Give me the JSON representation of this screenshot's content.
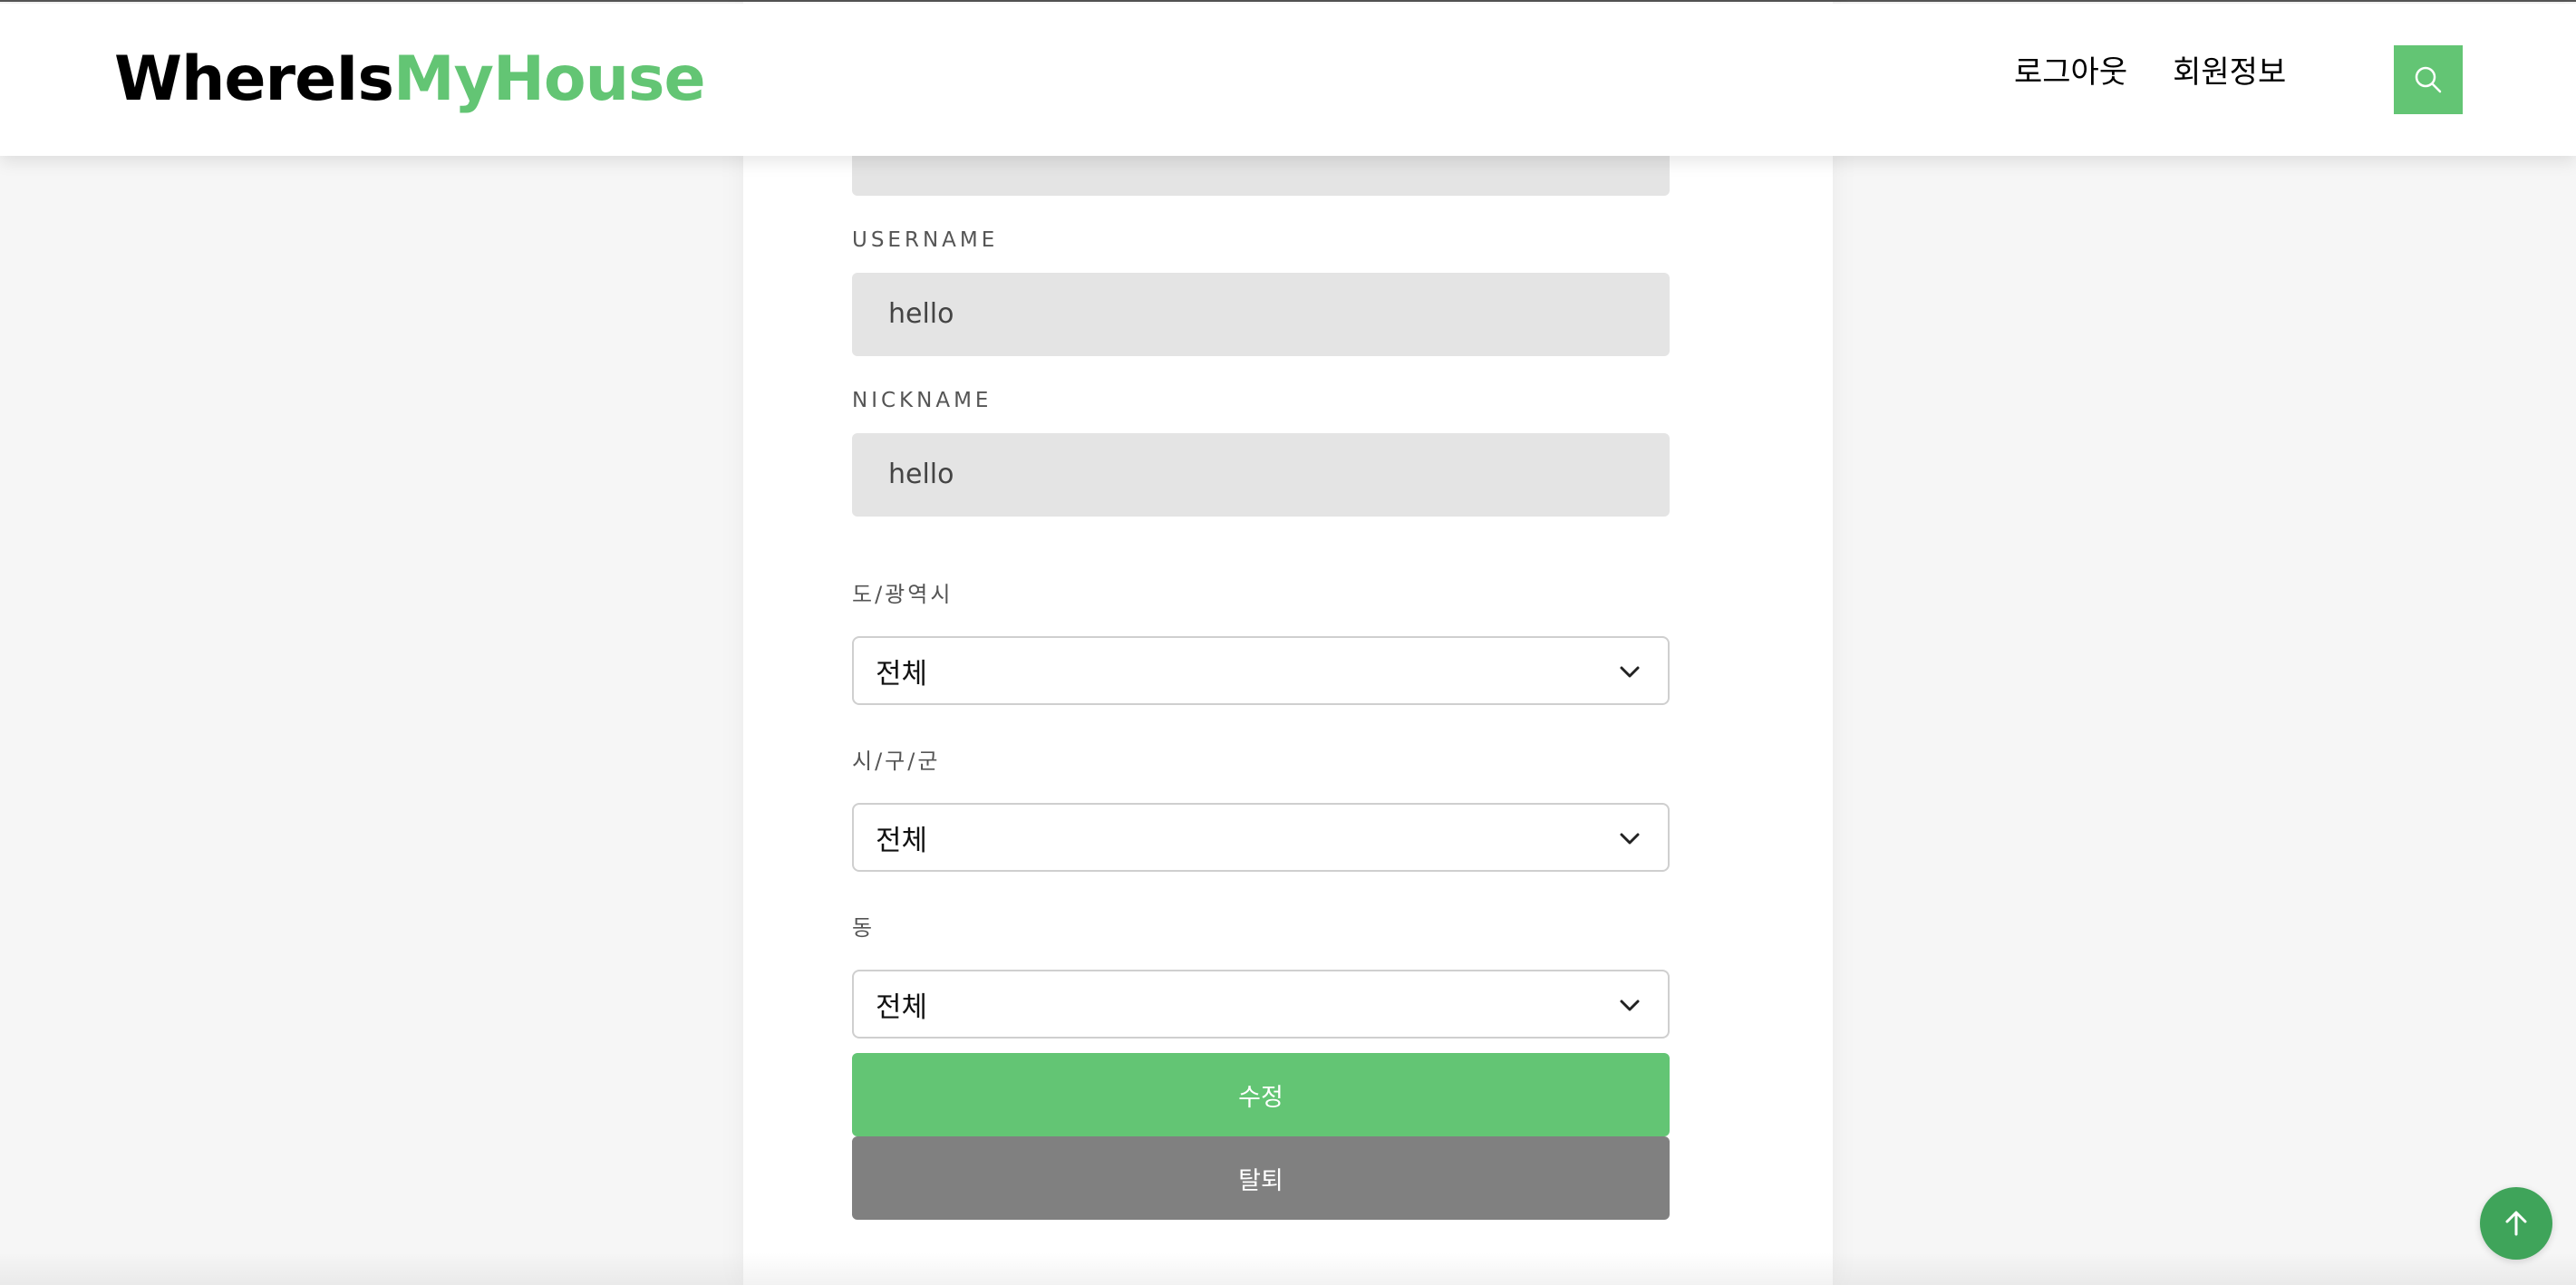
{
  "header": {
    "logo_part1": "WhereIs",
    "logo_part2": "MyHouse",
    "nav": {
      "logout": "로그아웃",
      "member_info": "회원정보"
    },
    "search_icon": "search-icon"
  },
  "form": {
    "username": {
      "label": "USERNAME",
      "value": "hello"
    },
    "nickname": {
      "label": "NICKNAME",
      "value": "hello"
    },
    "sido": {
      "label": "도/광역시",
      "selected": "전체"
    },
    "gugun": {
      "label": "시/구/군",
      "selected": "전체"
    },
    "dong": {
      "label": "동",
      "selected": "전체"
    },
    "buttons": {
      "update": "수정",
      "withdraw": "탈퇴"
    }
  },
  "scroll_top_icon": "arrow-up-icon",
  "colors": {
    "brand_green": "#63c574",
    "gray_button": "#808080",
    "input_bg": "#e4e4e4"
  }
}
